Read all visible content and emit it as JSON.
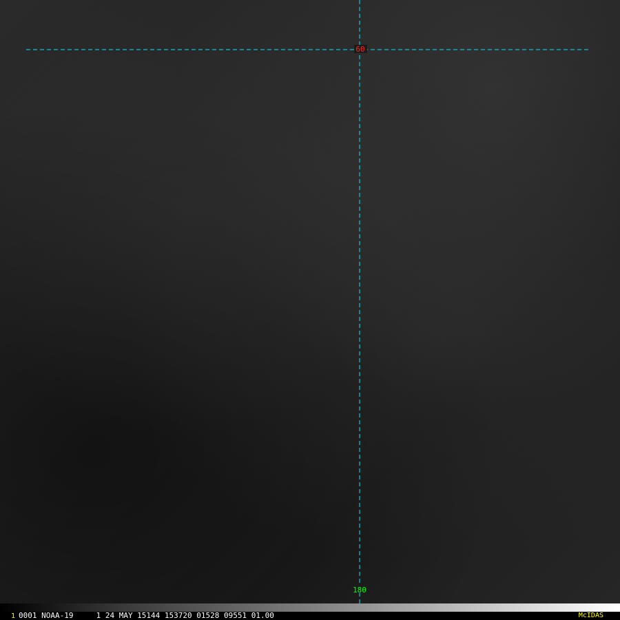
{
  "grid": {
    "latitude_label": "60",
    "longitude_label": "180",
    "line_color": "#00e5ff",
    "latitude_label_color": "#ff2020",
    "longitude_label_color": "#00ff00"
  },
  "footer": {
    "frame_number": "1",
    "image_info": "0001 NOAA-19     1 24 MAY 15144 153720 01528 09551 01.00",
    "software_label": "McIDAS",
    "frame_number_color": "#ffff00",
    "software_label_color": "#ffff00"
  }
}
